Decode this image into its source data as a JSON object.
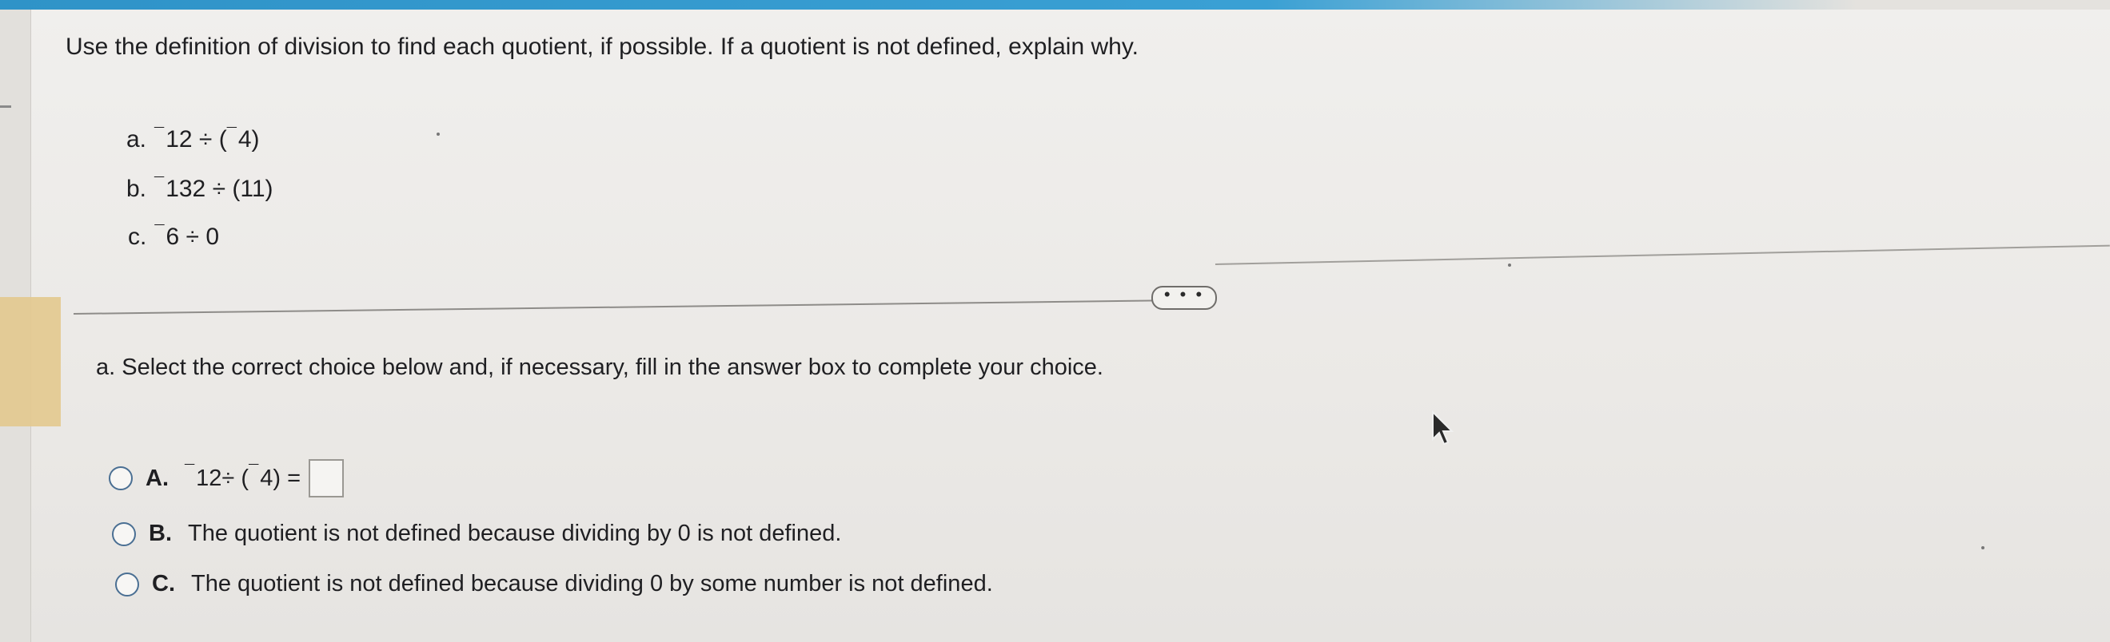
{
  "question": {
    "text": "Use the definition of division to find each quotient, if possible. If a quotient is not defined, explain why.",
    "items": [
      {
        "label": "a.",
        "dividend": "12",
        "divisor": "4",
        "expr_rest": " ÷ (",
        "close": ")"
      },
      {
        "label": "b.",
        "dividend": "132",
        "expr": " ÷ (11)"
      },
      {
        "label": "c.",
        "dividend": "6",
        "expr": " ÷ 0"
      }
    ]
  },
  "more_button": "• • •",
  "part_a": {
    "prompt": "a. Select the correct choice below and, if necessary, fill in the answer box to complete your choice.",
    "choices": [
      {
        "letter": "A.",
        "dividend": "12",
        "mid": " ÷ (",
        "divisor": "4",
        "end": ") ="
      },
      {
        "letter": "B.",
        "text": "The quotient is not defined because dividing by 0 is not defined."
      },
      {
        "letter": "C.",
        "text": "The quotient is not defined because dividing 0 by some number is not defined."
      }
    ]
  },
  "neg_mark": "¯"
}
